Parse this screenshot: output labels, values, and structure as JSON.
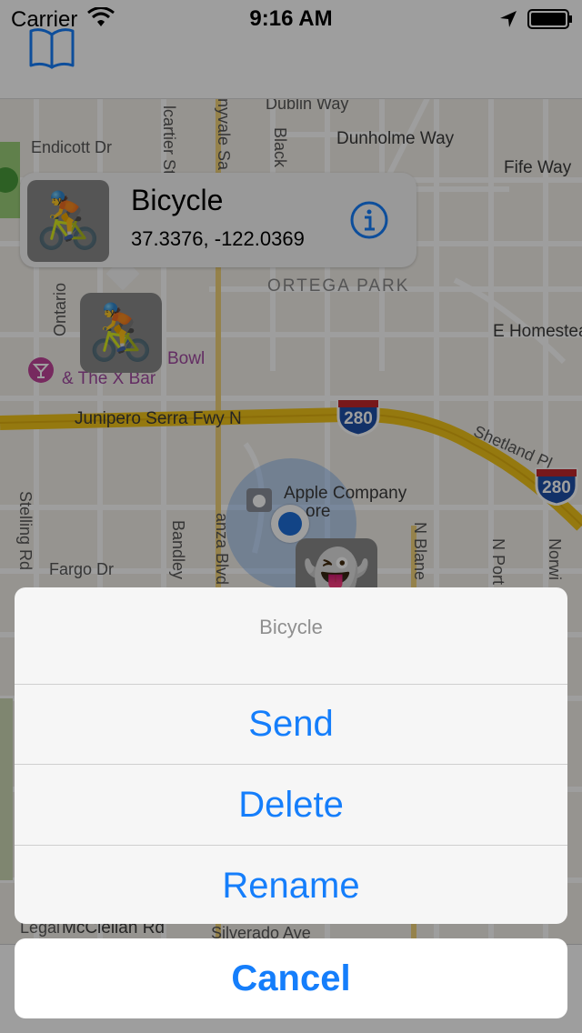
{
  "status_bar": {
    "carrier": "Carrier",
    "time": "9:16 AM"
  },
  "nav": {
    "icon": "book-icon"
  },
  "map": {
    "streets": {
      "dublin_way": "Dublin Way",
      "endicott_dr": "Endicott Dr",
      "dunholme_way": "Dunholme Way",
      "fife_way": "Fife Way",
      "ortega_park": "ORTEGA PARK",
      "e_homestead": "E Homestea",
      "ontario": "Ontario",
      "junipero": "Junipero Serra Fwy N",
      "shetland": "Shetland Pl",
      "stelling": "Stelling Rd",
      "fargo": "Fargo Dr",
      "bandley": "Bandley",
      "anza": "anza Blvd",
      "n_blaney": "N Blane",
      "n_portal": "N Port",
      "n_norwick": "Norwi",
      "apple_company": "Apple Company",
      "apple_store": "ore",
      "cartier": "lcartier St",
      "yvale": "nyvale Sa",
      "black": "Black",
      "bowl": "Bowl",
      "x_bar": "& The X Bar",
      "legal": "Legal",
      "mcclellan": "McClellan Rd",
      "silverado": "Silverado Ave"
    },
    "highway_shield": "280",
    "highway_shield_2": "280"
  },
  "callout": {
    "title": "Bicycle",
    "coordinates": "37.3376, -122.0369",
    "thumb_emoji": "🚴",
    "info_icon": "info-icon"
  },
  "pins": {
    "bicycle_emoji": "🚴",
    "ghost_emoji": "👻"
  },
  "action_sheet": {
    "title": "Bicycle",
    "buttons": [
      "Send",
      "Delete",
      "Rename"
    ],
    "cancel": "Cancel"
  },
  "colors": {
    "accent": "#157efb",
    "highway": "#f0c419",
    "user_dot": "#1e6fd9"
  }
}
